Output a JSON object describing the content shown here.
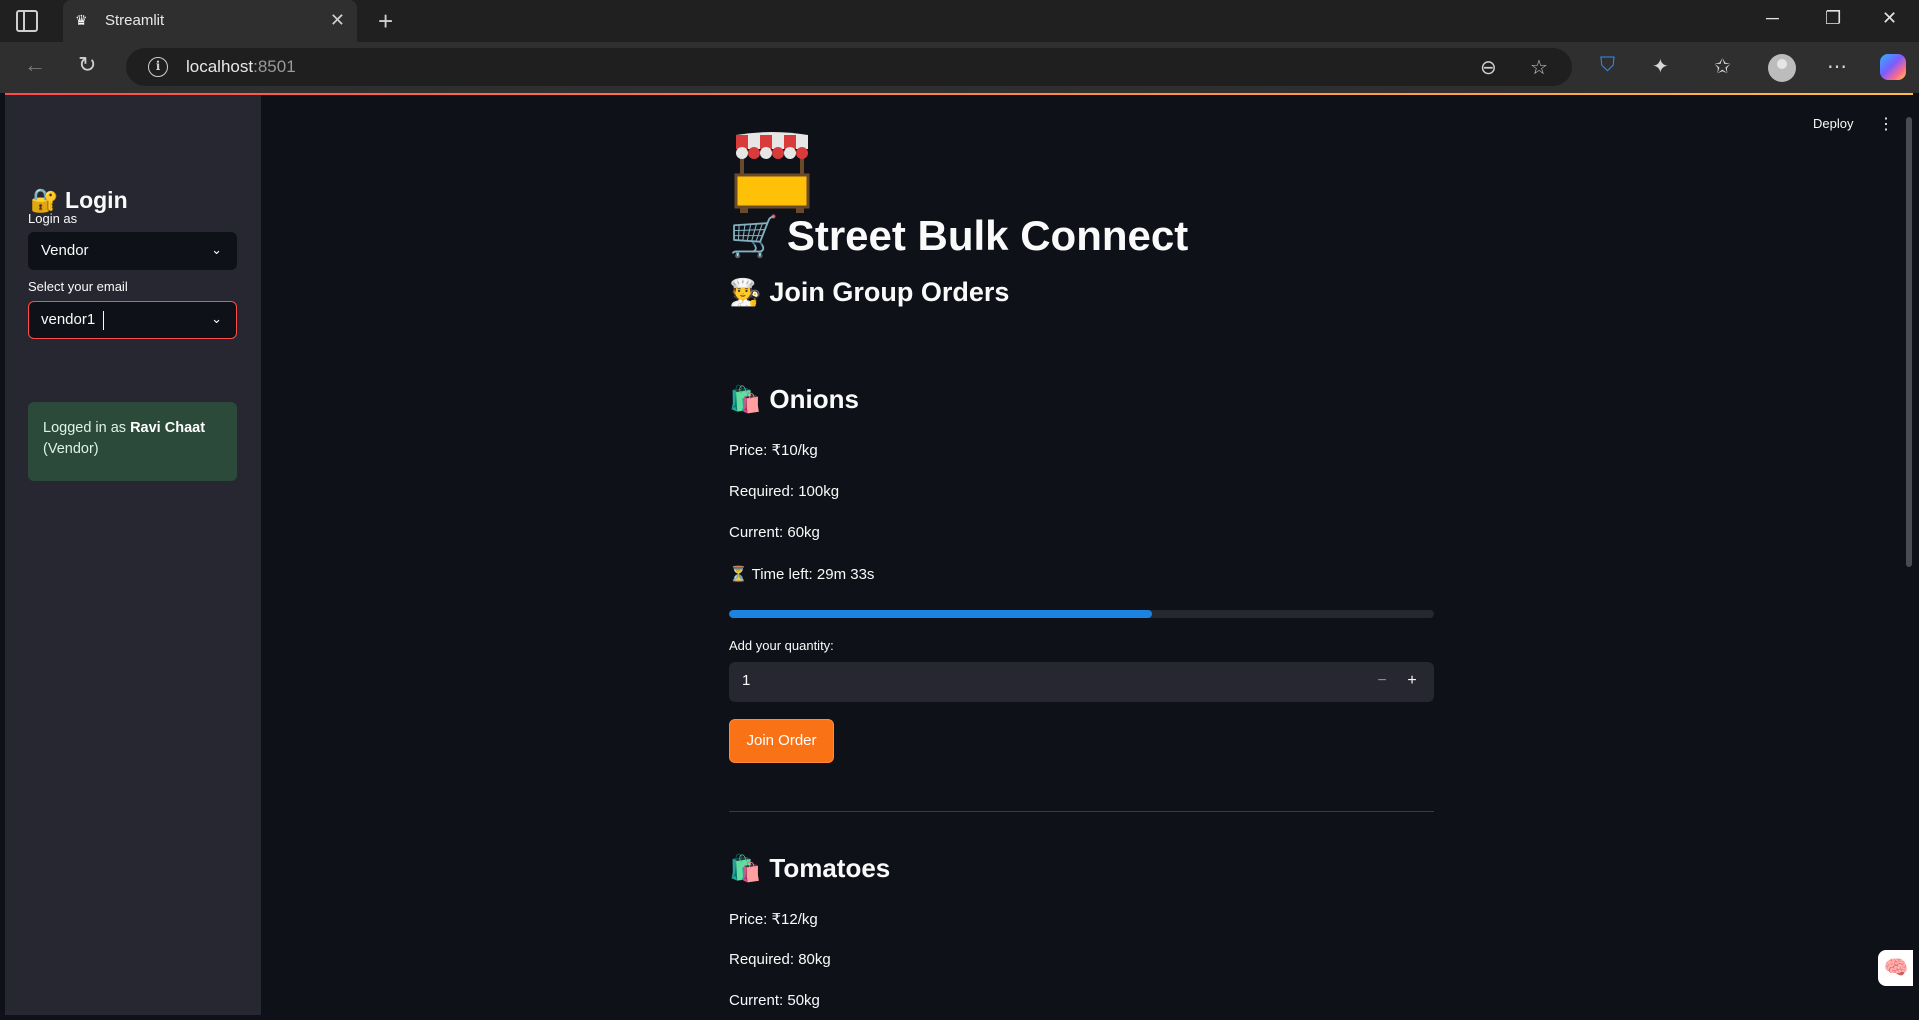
{
  "browser": {
    "tab_title": "Streamlit",
    "tab_favicon": "crown-icon",
    "url_host": "localhost",
    "url_port": ":8501"
  },
  "sidebar": {
    "title": "Login",
    "title_icon": "🔐",
    "login_as_label": "Login as",
    "login_as_value": "Vendor",
    "email_label": "Select your email",
    "email_value": "vendor1",
    "status_prefix": "Logged in as ",
    "status_name": "Ravi Chaat",
    "status_role": "(Vendor)"
  },
  "header": {
    "deploy_label": "Deploy"
  },
  "main": {
    "title": "Street Bulk Connect",
    "title_icon": "🛒",
    "subtitle": "Join Group Orders",
    "subtitle_icon": "🧑‍🍳",
    "products": [
      {
        "icon": "🛍️",
        "name": "Onions",
        "price": "Price: ₹10/kg",
        "required": "Required: 100kg",
        "current": "Current: 60kg",
        "time_icon": "⏳",
        "time_left": "Time left: 29m 33s",
        "progress": 0.6,
        "quantity_label": "Add your quantity:",
        "quantity_value": "1",
        "join_label": "Join Order"
      },
      {
        "icon": "🛍️",
        "name": "Tomatoes",
        "price": "Price: ₹12/kg",
        "required": "Required: 80kg",
        "current": "Current: 50kg"
      }
    ]
  },
  "colors": {
    "progress": "#1c83e1",
    "button": "#f97316",
    "success_bg": "#2b4a3a",
    "focus_border": "#ff4b4b"
  }
}
